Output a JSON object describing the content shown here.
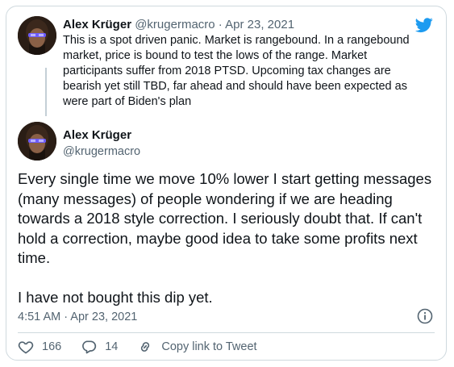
{
  "reply": {
    "author_name": "Alex Krüger",
    "author_handle": "@krugermacro",
    "separator": "·",
    "date": "Apr 23, 2021",
    "text": "This is a spot driven panic. Market is rangebound. In a rangebound market, price is bound to test the lows of the range. Market participants suffer from 2018 PTSD. Upcoming tax changes are bearish yet still TBD, far ahead and should have been expected as were part of Biden's plan"
  },
  "tweet": {
    "author_name": "Alex Krüger",
    "author_handle": "@krugermacro",
    "paragraphs": [
      "Every single time we move 10% lower I start getting messages (many messages) of people wondering if we are heading towards a 2018 style correction. I seriously doubt that. If can't hold a correction, maybe good idea to take some profits next time.",
      "I have not bought this dip yet."
    ],
    "timestamp": "4:51 AM · Apr 23, 2021"
  },
  "actions": {
    "likes": "166",
    "replies": "14",
    "copy_link": "Copy link to Tweet"
  },
  "icons": {
    "brand": "twitter-bird-icon",
    "info": "info-icon",
    "like": "heart-icon",
    "reply": "speech-bubble-icon",
    "link": "link-icon"
  },
  "colors": {
    "twitter_blue": "#1d9bf0",
    "text": "#0f1419",
    "muted": "#536471",
    "border": "#cfd9de"
  }
}
